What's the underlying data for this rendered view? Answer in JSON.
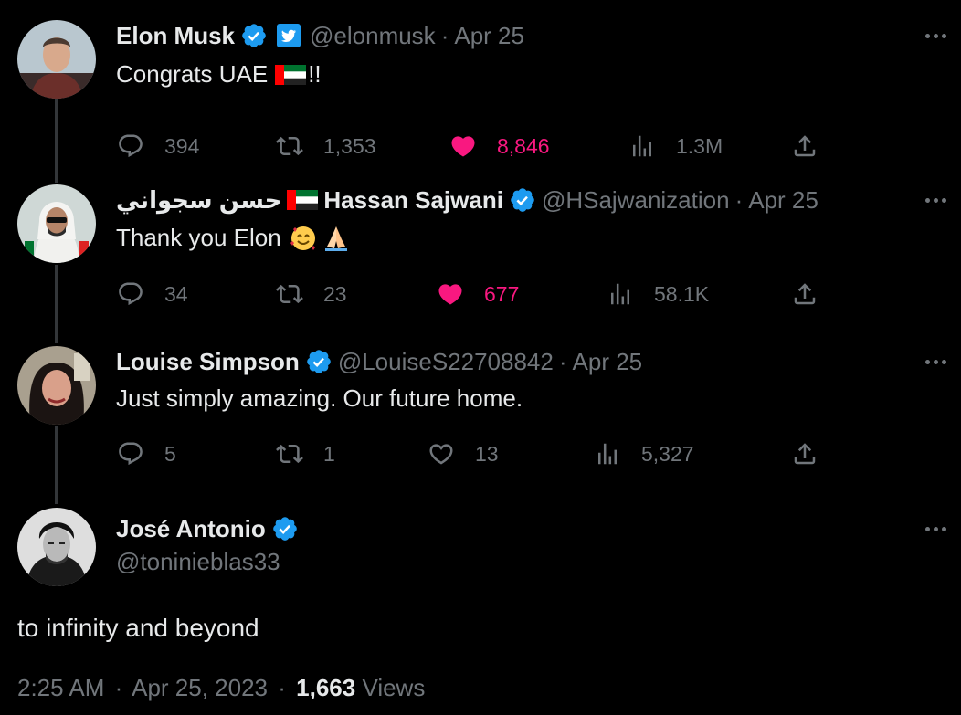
{
  "tweets": [
    {
      "name": "Elon Musk",
      "handle": "@elonmusk",
      "date": "Apr 25",
      "text": "Congrats UAE",
      "text_suffix": "!!",
      "stats": {
        "replies": "394",
        "retweets": "1,353",
        "likes": "8,846",
        "views": "1.3M"
      },
      "liked": true
    },
    {
      "name_arabic": "حسن سجواني",
      "name": "Hassan Sajwani",
      "handle": "@HSajwanization",
      "date": "Apr 25",
      "text": "Thank you Elon",
      "stats": {
        "replies": "34",
        "retweets": "23",
        "likes": "677",
        "views": "58.1K"
      },
      "liked": true
    },
    {
      "name": "Louise Simpson",
      "handle": "@LouiseS22708842",
      "date": "Apr 25",
      "text": "Just simply amazing. Our future home.",
      "stats": {
        "replies": "5",
        "retweets": "1",
        "likes": "13",
        "views": "5,327"
      },
      "liked": false
    }
  ],
  "main_tweet": {
    "name": "José Antonio",
    "handle": "@toninieblas33",
    "text": "to infinity and beyond",
    "time": "2:25 AM",
    "date": "Apr 25, 2023",
    "views_count": "1,663",
    "views_label": "Views"
  },
  "separator": "·",
  "colors": {
    "background": "#000000",
    "text": "#e7e9ea",
    "muted": "#71767b",
    "like": "#f91880",
    "verified": "#1d9bf0"
  },
  "icons": [
    "reply-icon",
    "retweet-icon",
    "like-icon",
    "views-icon",
    "share-icon",
    "verified-icon",
    "more-icon"
  ]
}
